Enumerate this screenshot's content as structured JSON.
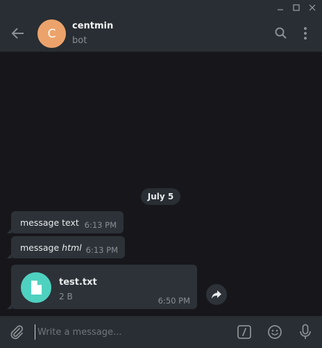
{
  "window": {
    "controls": [
      "minimize",
      "maximize",
      "close"
    ]
  },
  "header": {
    "avatar_letter": "C",
    "peer_name": "centmin",
    "peer_status": "bot",
    "icons": [
      "back-arrow-icon",
      "search-icon",
      "more-vertical-icon"
    ]
  },
  "chat": {
    "date_separator": "July 5",
    "messages": [
      {
        "text": "message text",
        "time": "6:13 PM"
      },
      {
        "text_plain": "message ",
        "text_italic": "html",
        "time": "6:13 PM"
      }
    ],
    "file_message": {
      "file_name": "test.txt",
      "file_size": "2 B",
      "time": "6:50 PM",
      "icon": "file-icon"
    }
  },
  "composer": {
    "placeholder": "Write a message...",
    "icons": [
      "attach-icon",
      "bot-command-icon",
      "emoji-icon",
      "microphone-icon"
    ]
  },
  "colors": {
    "header_bg": "#282e33",
    "chat_bg": "#17171b",
    "bubble_bg": "#2c3238",
    "avatar_bg": "#eca36b",
    "file_icon_bg": "#4fd1c0"
  }
}
